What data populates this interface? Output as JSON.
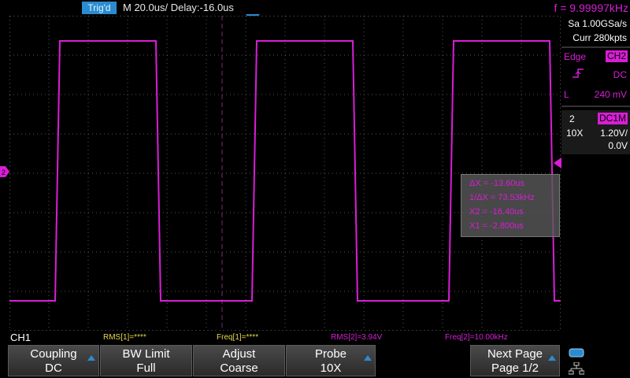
{
  "top": {
    "trig_status": "Trig'd",
    "timebase": "M 20.0us/  Delay:-16.0us",
    "frequency": "f = 9.99997kHz"
  },
  "right_panel": {
    "sample_rate": "Sa 1.00GSa/s",
    "memory_depth": "Curr 280kpts",
    "trigger_type": "Edge",
    "trigger_source": "CH2",
    "trigger_coupling": "DC",
    "trigger_level_prefix": "L",
    "trigger_level": "240 mV",
    "channel_number": "2",
    "channel_coupling": "DC1M",
    "channel_probe": "10X",
    "channel_scale": "1.20V/",
    "channel_offset": "0.0V"
  },
  "cursor_box": {
    "delta_x": "ΔX = -13.60us",
    "inv_delta_x": "1/ΔX = 73.53kHz",
    "x2": "X2 = -16.40us",
    "x1": "X1 = -2.800us"
  },
  "bottom_status": {
    "channel": "CH1",
    "rms1": "RMS[1]=****",
    "freq1": "Freq[1]=****",
    "rms2": "RMS[2]=3.94V",
    "freq2": "Freq[2]=10.00kHz"
  },
  "softkeys": [
    {
      "line1": "Coupling",
      "line2": "DC"
    },
    {
      "line1": "BW Limit",
      "line2": "Full"
    },
    {
      "line1": "Adjust",
      "line2": "Coarse"
    },
    {
      "line1": "Probe",
      "line2": "10X"
    },
    {
      "line1": "Next Page",
      "line2": "Page 1/2"
    }
  ],
  "colors": {
    "ch2_trace": "#d81ed6",
    "accent": "#2b8bd0",
    "meas_yellow": "#e8d84a"
  },
  "icons": {
    "usb": "usb-icon",
    "network": "network-icon"
  }
}
